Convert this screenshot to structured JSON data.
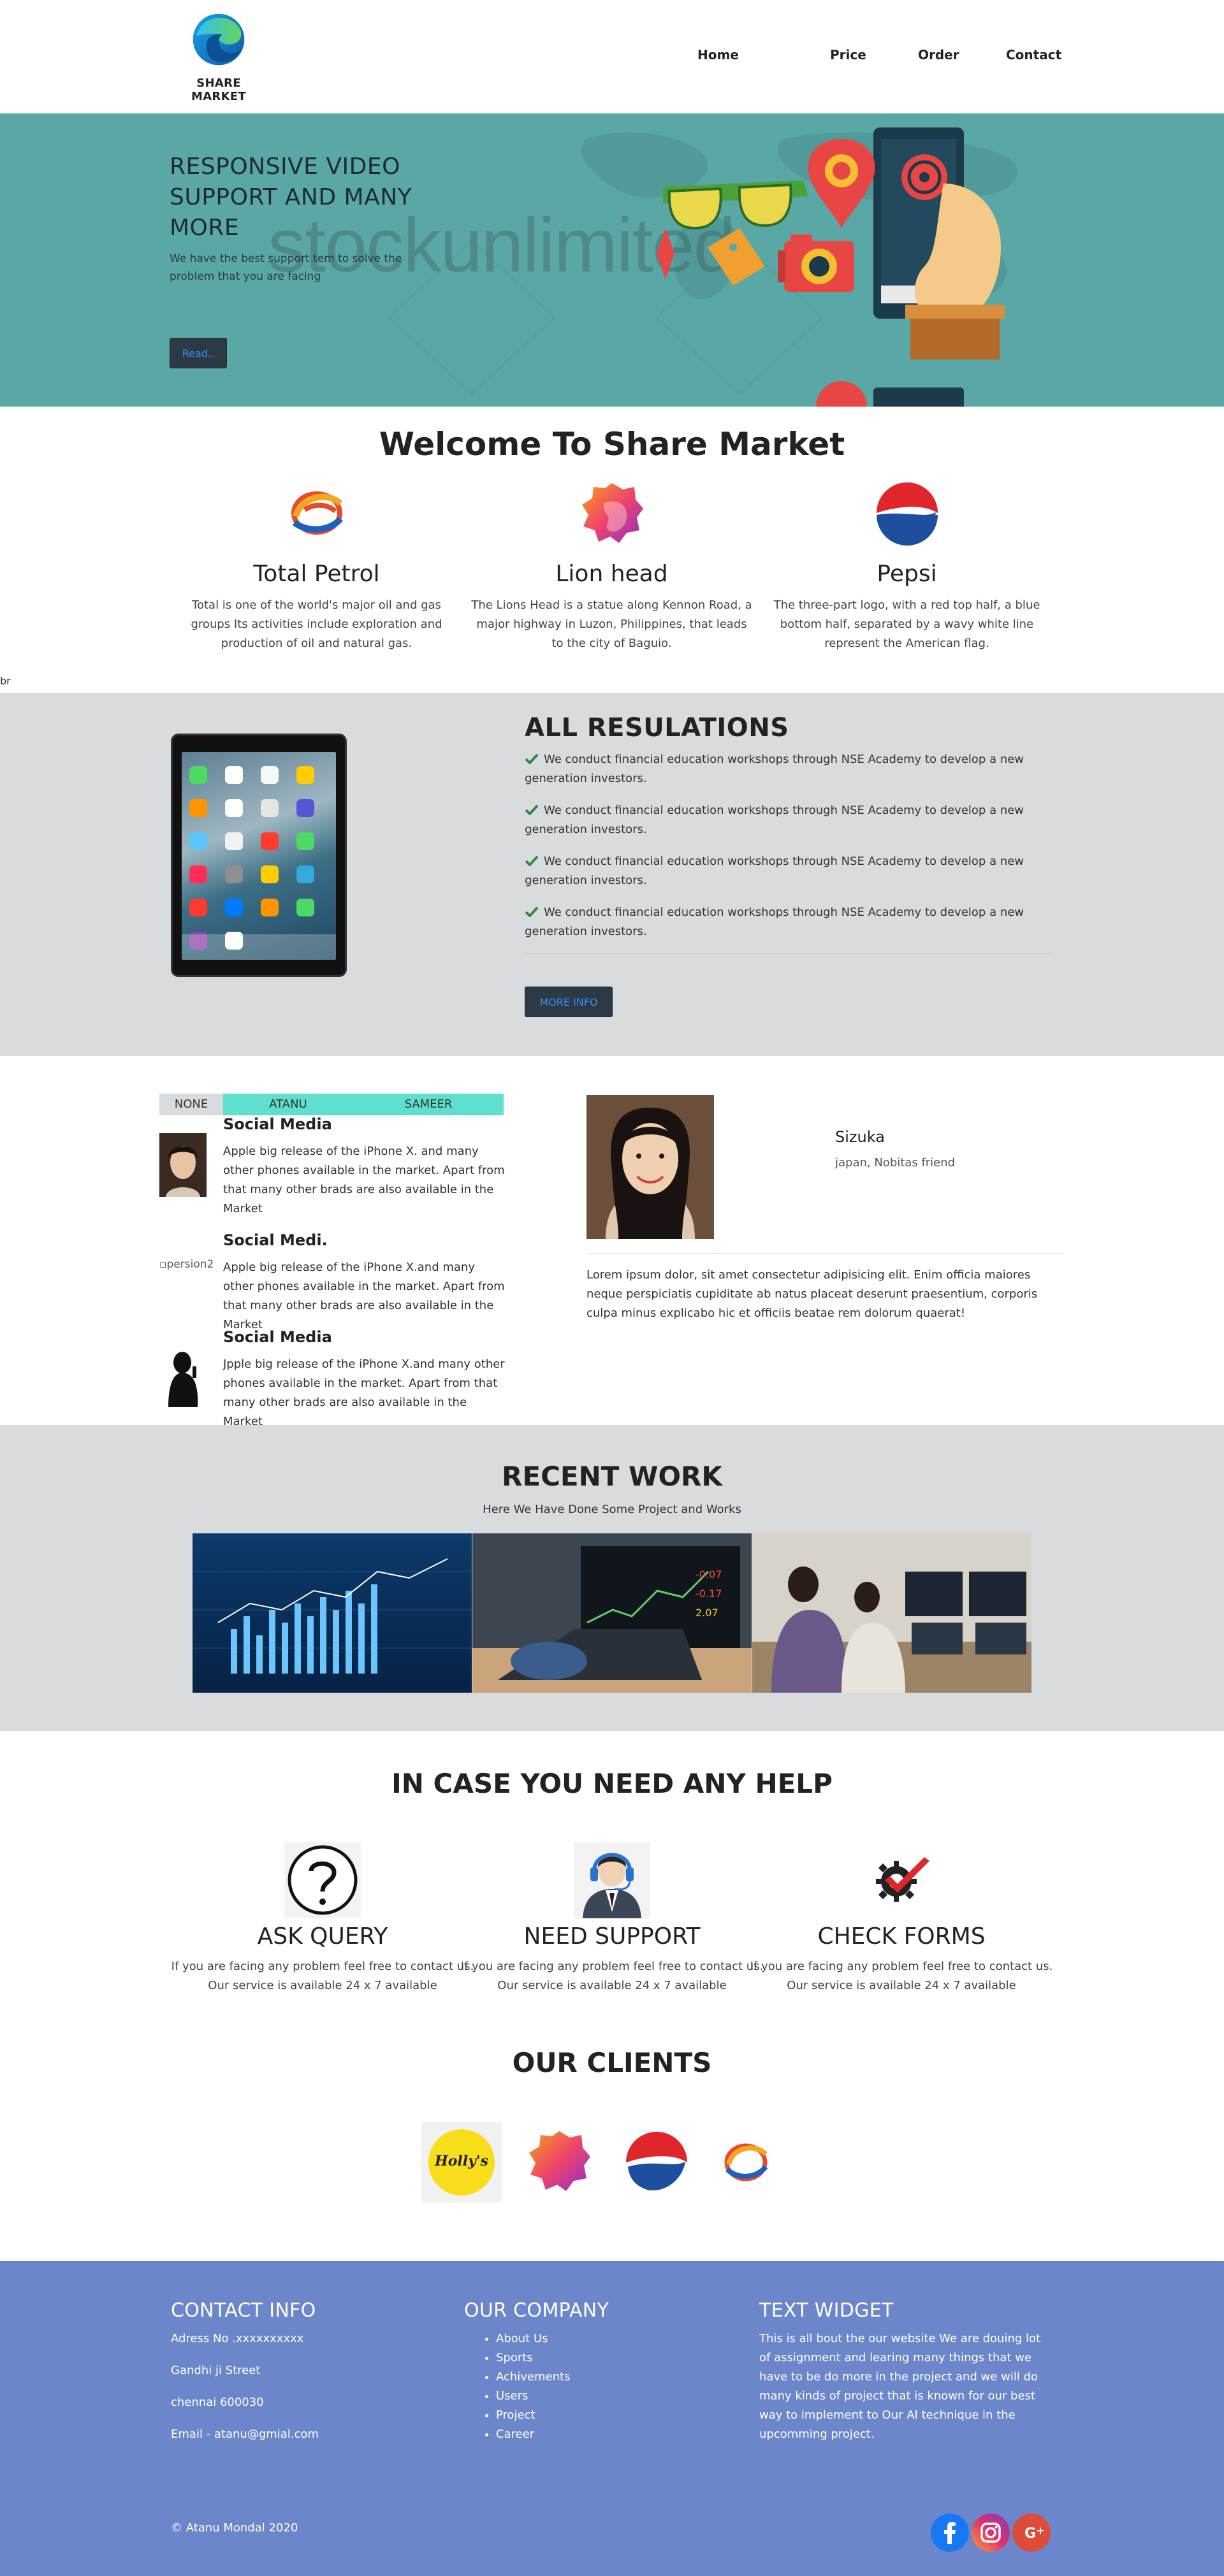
{
  "header": {
    "brand": "SHARE MARKET",
    "nav": [
      "Home",
      "Price",
      "Order",
      "Contact"
    ]
  },
  "hero": {
    "title": "RESPONSIVE VIDEO SUPPORT AND MANY MORE",
    "text": "We have the best support tem to solve the problem that you are facing",
    "button": "Read..",
    "watermark": "stockunlimited"
  },
  "welcome": {
    "title": "Welcome To Share Market",
    "features": [
      {
        "title": "Total Petrol",
        "text": "Total is one of the world's major oil and gas groups Its activities include exploration and production of oil and natural gas.",
        "logo": "total-logo"
      },
      {
        "title": "Lion head",
        "text": "The Lions Head is a statue along Kennon Road, a major highway in Luzon, Philippines, that leads to the city of Baguio.",
        "logo": "lion-logo"
      },
      {
        "title": "Pepsi",
        "text": "The three-part logo, with a red top half, a blue bottom half, separated by a wavy white line represent the American flag.",
        "logo": "pepsi-logo"
      }
    ]
  },
  "stray_text": "br",
  "regulations": {
    "title": "ALL RESULATIONS",
    "items": [
      "We conduct financial education workshops through NSE Academy to develop a new generation investors.",
      "We conduct financial education workshops through NSE Academy to develop a new generation investors.",
      "We conduct financial education workshops through NSE Academy to develop a new generation investors.",
      "We conduct financial education workshops through NSE Academy to develop a new generation investors."
    ],
    "button": "MORE INFO"
  },
  "tabs": [
    "NONE",
    "ATANU",
    "SAMEER"
  ],
  "media": [
    {
      "title": "Social Media",
      "text": "Apple big release of the iPhone X. and many other phones available in the market. Apart from that many other brads are also available in the Market"
    },
    {
      "title": "Social Medi.",
      "text": "Apple big release of the iPhone X.and many other phones available in the market. Apart from that many other brads are also available in the Market",
      "broken_alt": "persion2"
    },
    {
      "title": "Social Media",
      "text": "Jpple big release of the iPhone X.and many other phones available in the market. Apart from that many other brads are also available in the Market"
    }
  ],
  "profile": {
    "name": "Sizuka",
    "role": "japan, Nobitas friend",
    "text": "Lorem ipsum dolor, sit amet consectetur adipisicing elit. Enim officia maiores neque perspiciatis cupiditate ab natus placeat deserunt praesentium, corporis culpa minus explicabo hic et officiis beatae rem dolorum quaerat!"
  },
  "recent": {
    "title": "RECENT WORK",
    "subtitle": "Here We Have Done Some Project and Works",
    "chart_numbers": [
      "-0.07",
      "-0.17",
      "2.07"
    ]
  },
  "help": {
    "title": "IN CASE YOU NEED ANY HELP",
    "items": [
      {
        "title": "ASK QUERY",
        "text": "If you are facing any problem feel free to contact us. Our service is available 24 x 7 available",
        "icon": "question-icon"
      },
      {
        "title": "NEED SUPPORT",
        "text": "If you are facing any problem feel free to contact us. Our service is available 24 x 7 available",
        "icon": "headset-support-icon"
      },
      {
        "title": "CHECK FORMS",
        "text": "If you are facing any problem feel free to contact us. Our service is available 24 x 7 available",
        "icon": "gear-check-icon"
      }
    ]
  },
  "clients": {
    "title": "OUR CLIENTS",
    "logos": [
      "hollys-logo",
      "lion-logo",
      "pepsi-logo",
      "total-logo"
    ],
    "hollys_text": "Holly's"
  },
  "footer": {
    "contact_title": "CONTACT INFO",
    "contact_lines": [
      "Adress No .xxxxxxxxxx",
      "Gandhi ji Street",
      "chennai 600030",
      "Email - atanu@gmial.com"
    ],
    "company_title": "OUR COMPANY",
    "company_links": [
      "About Us",
      "Sports",
      "Achivements",
      "Users",
      "Project",
      "Career"
    ],
    "widget_title": "TEXT WIDGET",
    "widget_text": "This is all bout the our website We are douing lot of assignment and learing many things that we have to be do more in the project and we will do many kinds of project that is known for our best way to implement to Our AI technique in the upcomming project.",
    "copyright": "© Atanu Mondal 2020",
    "social": [
      "facebook-icon",
      "instagram-icon",
      "google-plus-icon"
    ]
  },
  "colors": {
    "hero_bg": "#5aa8a6",
    "section_gray": "#d9dcdf",
    "tab_active": "#5fe0cf",
    "footer_bg": "#6b86cb",
    "button_bg": "#2b3a45",
    "button_text": "#3e8ef7"
  }
}
